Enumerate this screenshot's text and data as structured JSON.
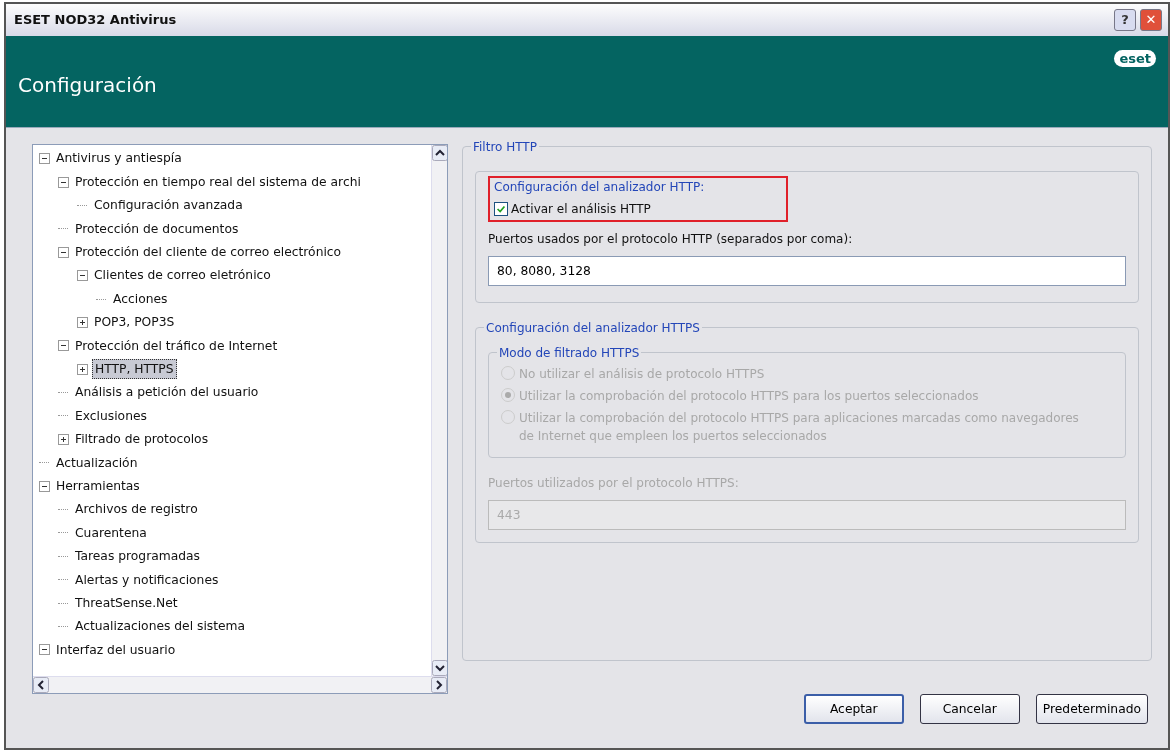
{
  "window": {
    "title": "ESET NOD32 Antivirus",
    "buttons": [
      {
        "kind": "help",
        "label": "?"
      },
      {
        "kind": "close",
        "label": "✕"
      }
    ]
  },
  "header": {
    "title": "Configuración",
    "logo": "eset"
  },
  "tree": {
    "items": [
      {
        "label": "Antivirus y antiespía",
        "expanded": true,
        "selected": false,
        "children": [
          {
            "label": "Protección en tiempo real del sistema de archi",
            "expanded": true,
            "selected": false,
            "children": [
              {
                "label": "Configuración avanzada",
                "selected": false
              }
            ]
          },
          {
            "label": "Protección de documentos",
            "selected": false
          },
          {
            "label": "Protección del cliente de correo electrónico",
            "expanded": true,
            "selected": false,
            "children": [
              {
                "label": "Clientes de correo eletrónico",
                "expanded": true,
                "selected": false,
                "children": [
                  {
                    "label": "Acciones",
                    "selected": false
                  }
                ]
              },
              {
                "label": "POP3, POP3S",
                "expanded": false,
                "selected": false
              }
            ]
          },
          {
            "label": "Protección del tráfico de Internet",
            "expanded": true,
            "selected": false,
            "children": [
              {
                "label": "HTTP, HTTPS",
                "expanded": false,
                "selected": true
              }
            ]
          },
          {
            "label": "Análisis a petición del usuario",
            "selected": false
          },
          {
            "label": "Exclusiones",
            "selected": false
          },
          {
            "label": "Filtrado de protocolos",
            "expanded": false,
            "selected": false
          }
        ]
      },
      {
        "label": "Actualización",
        "selected": false
      },
      {
        "label": "Herramientas",
        "expanded": true,
        "selected": false,
        "children": [
          {
            "label": "Archivos de registro",
            "selected": false
          },
          {
            "label": "Cuarentena",
            "selected": false
          },
          {
            "label": "Tareas programadas",
            "selected": false
          },
          {
            "label": "Alertas y notificaciones",
            "selected": false
          },
          {
            "label": "ThreatSense.Net",
            "selected": false
          },
          {
            "label": "Actualizaciones del sistema",
            "selected": false
          }
        ]
      },
      {
        "label": "Interfaz del usuario",
        "expanded": true,
        "selected": false
      }
    ]
  },
  "http_filter": {
    "title": "Filtro HTTP",
    "analyzer": {
      "title": "Configuración del analizador HTTP:",
      "highlighted": true,
      "checkbox": {
        "label": "Activar el análisis HTTP",
        "checked": true
      }
    },
    "ports_label": "Puertos usados por el protocolo HTTP (separados por coma):",
    "ports_value": "80, 8080, 3128"
  },
  "https_analyzer": {
    "title": "Configuración del analizador HTTPS",
    "disabled": true,
    "mode": {
      "title": "Modo de filtrado HTTPS",
      "options": [
        {
          "label": "No utilizar el análisis de protocolo HTTPS",
          "selected": false
        },
        {
          "label": "Utilizar la comprobación del protocolo HTTPS para los puertos seleccionados",
          "selected": true
        },
        {
          "label": "Utilizar la comprobación del protocolo HTTPS para aplicaciones marcadas como navegadores de Internet que empleen los puertos seleccionados",
          "selected": false
        }
      ]
    },
    "ports_label": "Puertos utilizados por el protocolo HTTPS:",
    "ports_value": "443"
  },
  "buttons": [
    {
      "label": "Aceptar",
      "default": true
    },
    {
      "label": "Cancelar",
      "default": false
    },
    {
      "label": "Predeterminado",
      "default": false
    }
  ]
}
